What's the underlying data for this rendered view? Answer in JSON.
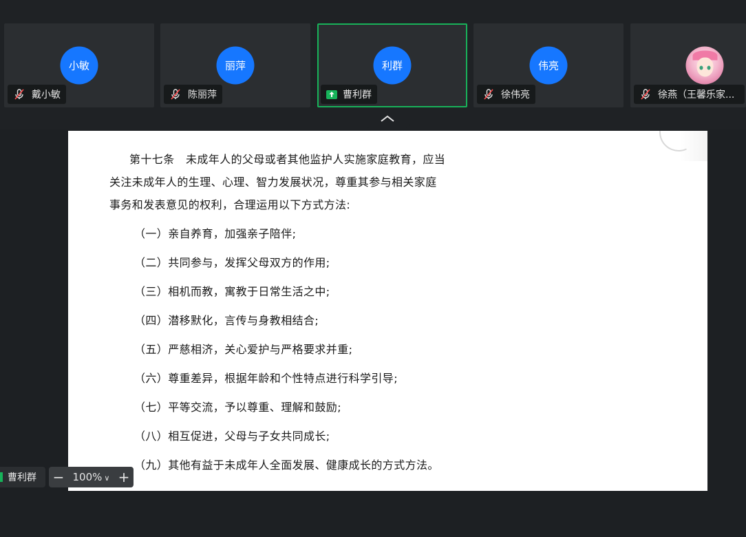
{
  "participants": [
    {
      "avatar_text": "小敏",
      "name": "戴小敏",
      "status": "muted"
    },
    {
      "avatar_text": "丽萍",
      "name": "陈丽萍",
      "status": "muted"
    },
    {
      "avatar_text": "利群",
      "name": "曹利群",
      "status": "sharing"
    },
    {
      "avatar_text": "伟亮",
      "name": "徐伟亮",
      "status": "muted"
    },
    {
      "avatar_text": "",
      "name": "徐燕（王馨乐家...",
      "status": "muted"
    }
  ],
  "colors": {
    "avatar": "#1677ff",
    "active_border": "#18b35a",
    "share": "#17b35a"
  },
  "document": {
    "heading_line1": "第十七条　未成年人的父母或者其他监护人实施家庭教育，应当",
    "heading_line2": "关注未成年人的生理、心理、智力发展状况，尊重其参与相关家庭",
    "heading_line3": "事务和发表意见的权利，合理运用以下方式方法:",
    "items": [
      "（一）亲自养育，加强亲子陪伴;",
      "（二）共同参与，发挥父母双方的作用;",
      "（三）相机而教，寓教于日常生活之中;",
      "（四）潜移默化，言传与身教相结合;",
      "（五）严慈相济，关心爱护与严格要求并重;",
      "（六）尊重差异，根据年龄和个性特点进行科学引导;",
      "（七）平等交流，予以尊重、理解和鼓励;",
      "（八）相互促进，父母与子女共同成长;",
      "（九）其他有益于未成年人全面发展、健康成长的方式方法。"
    ]
  },
  "presenter": {
    "name": "曹利群"
  },
  "zoom": {
    "minus": "−",
    "value": "100%",
    "caret": "∨",
    "plus": "+"
  }
}
